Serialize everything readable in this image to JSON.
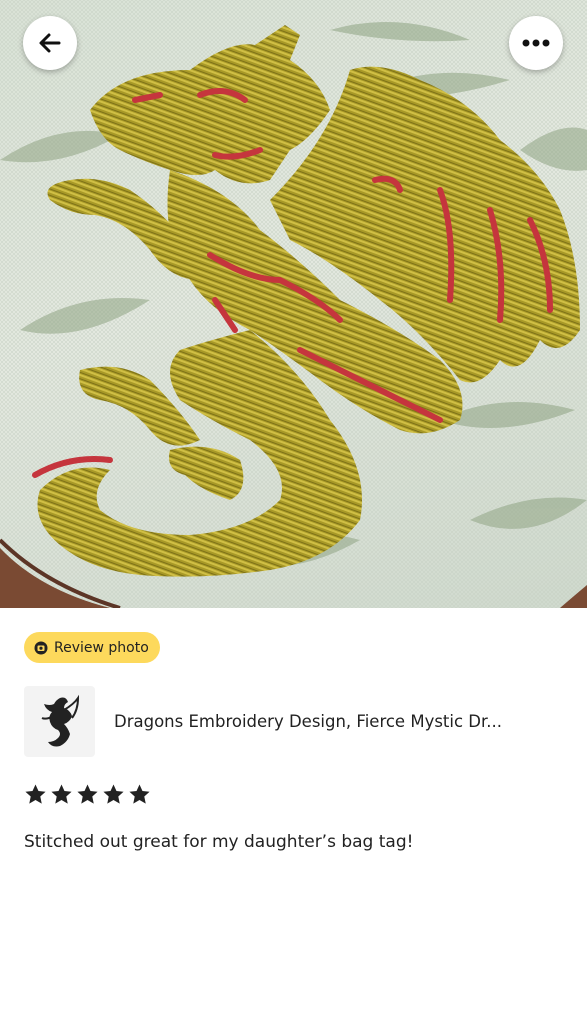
{
  "badge": {
    "label": "Review photo",
    "icon": "photo-badge-icon"
  },
  "listing": {
    "title": "Dragons Embroidery Design, Fierce Mystic Dr...",
    "thumbnail_icon": "dragon-thumbnail-icon"
  },
  "nav": {
    "back_icon": "arrow-left-icon",
    "more_icon": "more-horizontal-icon"
  },
  "review": {
    "rating": 5,
    "max_rating": 5,
    "text": "Stitched out great for my daughter’s bag tag!"
  },
  "colors": {
    "badge": "#fdd95c",
    "text": "#222222",
    "thread_gold": "#a99a26",
    "thread_red": "#c5353d"
  }
}
